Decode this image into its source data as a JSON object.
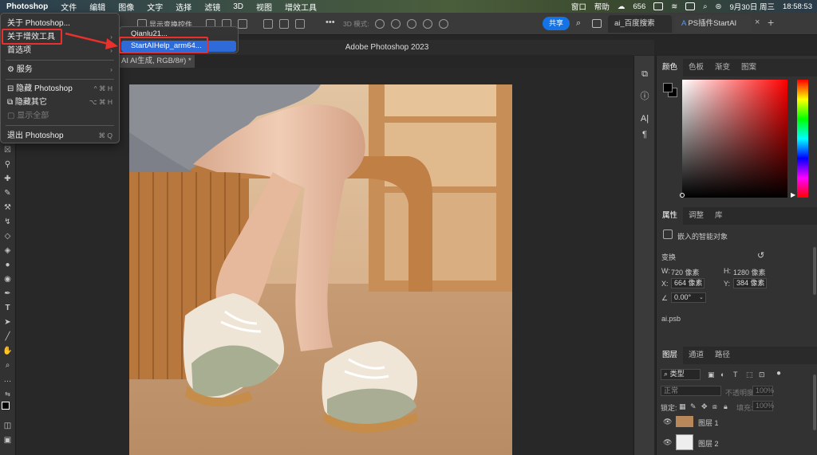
{
  "menubar": {
    "app": "Photoshop",
    "items": [
      "文件",
      "编辑",
      "图像",
      "文字",
      "选择",
      "滤镜",
      "3D",
      "视图",
      "增效工具"
    ],
    "right_items": [
      "窗口",
      "帮助"
    ],
    "temp": "656",
    "date": "9月30日 周三",
    "time": "18:58:53"
  },
  "optbar": {
    "show_transform": "显示变换控件",
    "mode_3d": "3D 模式:",
    "share": "共享",
    "tab1": "ai_百度搜索",
    "tab2": "PS插件StartAI"
  },
  "window": {
    "title": "Adobe Photoshop 2023",
    "doc_tab": "AI AI生成, RGB/8#) *"
  },
  "app_menu": {
    "items": [
      {
        "label": "关于 Photoshop...",
        "shortcut": "",
        "disabled": false
      },
      {
        "label": "关于增效工具",
        "shortcut": "",
        "disabled": false,
        "submenu": true
      },
      {
        "label": "首选项",
        "shortcut": "",
        "disabled": false,
        "submenu": true
      },
      {
        "label": "服务",
        "shortcut": "",
        "disabled": false,
        "submenu": true
      },
      {
        "label": "隐藏 Photoshop",
        "shortcut": "^ ⌘ H",
        "disabled": false
      },
      {
        "label": "隐藏其它",
        "shortcut": "⌥ ⌘ H",
        "disabled": false
      },
      {
        "label": "显示全部",
        "shortcut": "",
        "disabled": true
      },
      {
        "label": "退出 Photoshop",
        "shortcut": "⌘ Q",
        "disabled": false
      }
    ]
  },
  "submenu": {
    "items": [
      "Qianlu21...",
      "StartAIHelp_arm64..."
    ]
  },
  "color_panel": {
    "tabs": [
      "颜色",
      "色板",
      "渐变",
      "图案"
    ]
  },
  "properties": {
    "tabs": [
      "属性",
      "调整",
      "库"
    ],
    "type": "嵌入的智能对象",
    "transform": "变换",
    "w_label": "W:",
    "w": "720 像素",
    "h_label": "H:",
    "h": "1280 像素",
    "x_label": "X:",
    "x": "664 像素",
    "y_label": "Y:",
    "y": "384 像素",
    "angle": "0.00°",
    "file": "ai.psb"
  },
  "layers": {
    "tabs": [
      "图层",
      "通道",
      "路径"
    ],
    "filter": "类型",
    "blend": "正常",
    "opacity_label": "不透明度:",
    "opacity": "100%",
    "lock_label": "锁定:",
    "fill_label": "填充:",
    "fill": "100%",
    "items": [
      {
        "name": "图层 1"
      },
      {
        "name": "图层 2"
      }
    ]
  },
  "colors": {
    "accent": "#1473e6",
    "highlight": "#2f6ad9",
    "annotation": "#e8302c"
  }
}
